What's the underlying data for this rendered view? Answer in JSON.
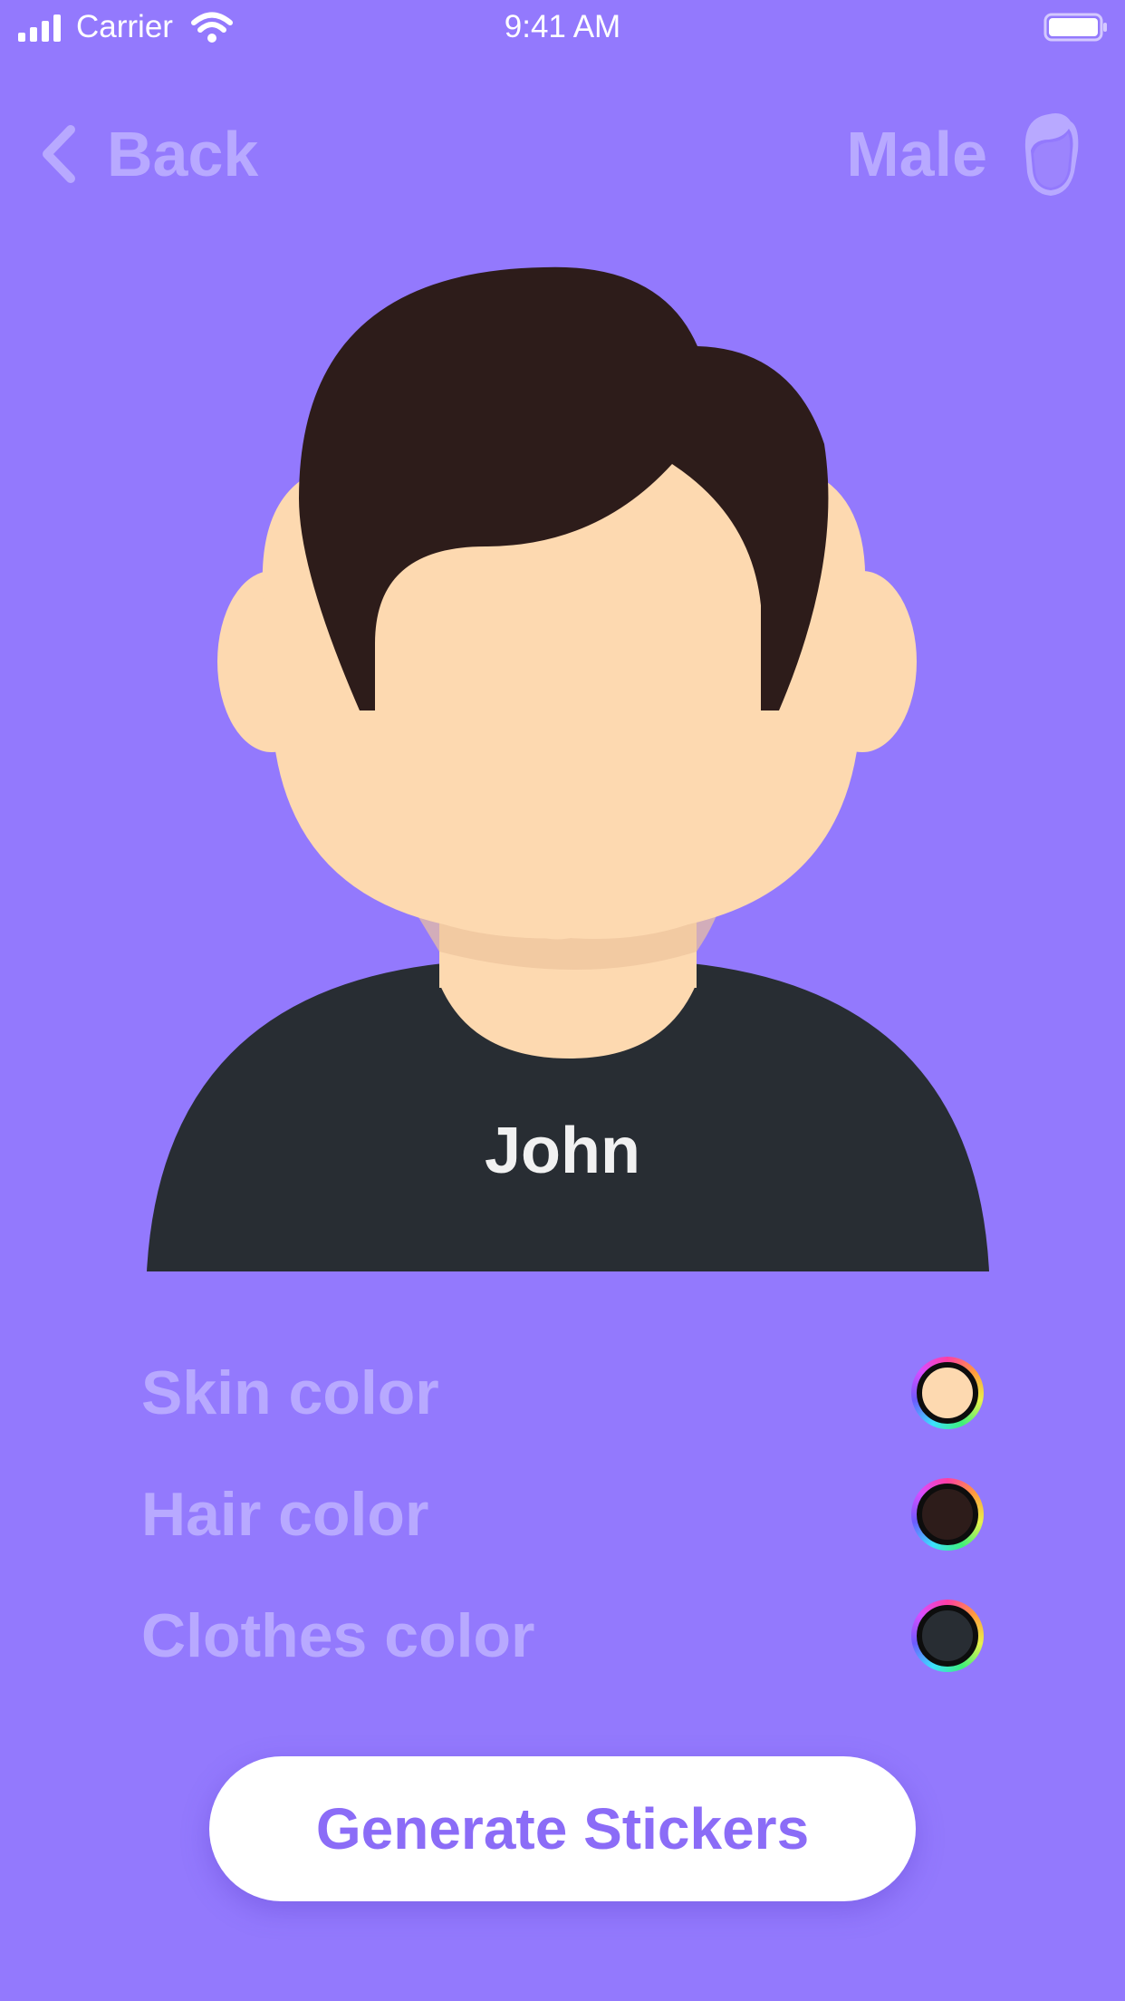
{
  "status_bar": {
    "carrier": "Carrier",
    "time": "9:41 AM",
    "icons": [
      "signal-icon",
      "wifi-icon",
      "battery-icon"
    ]
  },
  "nav": {
    "back_label": "Back",
    "back_icon": "chevron-left-icon",
    "gender_label": "Male",
    "gender_icon": "male-head-icon"
  },
  "avatar": {
    "name": "John",
    "skin_color": "#fdd9b0",
    "hair_color": "#2d1c1a",
    "clothes_color": "#282d33"
  },
  "options": [
    {
      "label": "Skin color",
      "color": "#fdd9b0"
    },
    {
      "label": "Hair color",
      "color": "#2d1c1a"
    },
    {
      "label": "Clothes color",
      "color": "#282d33"
    }
  ],
  "generate_button": {
    "label": "Generate Stickers"
  },
  "colors": {
    "background": "#9379fd",
    "accent": "#8b6cf7",
    "muted_label": "#b8a9ff"
  }
}
